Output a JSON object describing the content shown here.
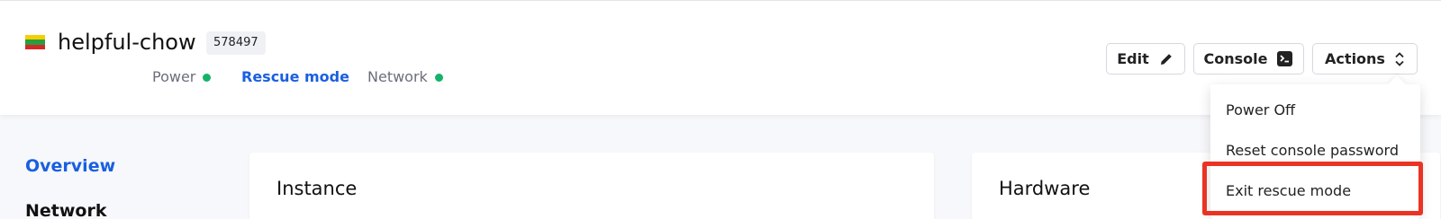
{
  "header": {
    "instance_name": "helpful-chow",
    "instance_id": "578497",
    "flag_colors": [
      "#f5d000",
      "#2a9d3e",
      "#d62728"
    ],
    "status": {
      "power_label": "Power",
      "power_dot_color": "#17b26a",
      "rescue_label": "Rescue mode",
      "network_label": "Network",
      "network_dot_color": "#17b26a"
    }
  },
  "toolbar": {
    "edit_label": "Edit",
    "console_label": "Console",
    "actions_label": "Actions"
  },
  "actions_menu": {
    "items": [
      {
        "label": "Power Off"
      },
      {
        "label": "Reset console password"
      },
      {
        "label": "Exit rescue mode"
      }
    ],
    "highlight_color": "#ea3323"
  },
  "sidebar": {
    "items": [
      {
        "label": "Overview",
        "active": true
      },
      {
        "label": "Network",
        "active": false
      }
    ]
  },
  "cards": {
    "instance_title": "Instance",
    "hardware_title": "Hardware"
  }
}
